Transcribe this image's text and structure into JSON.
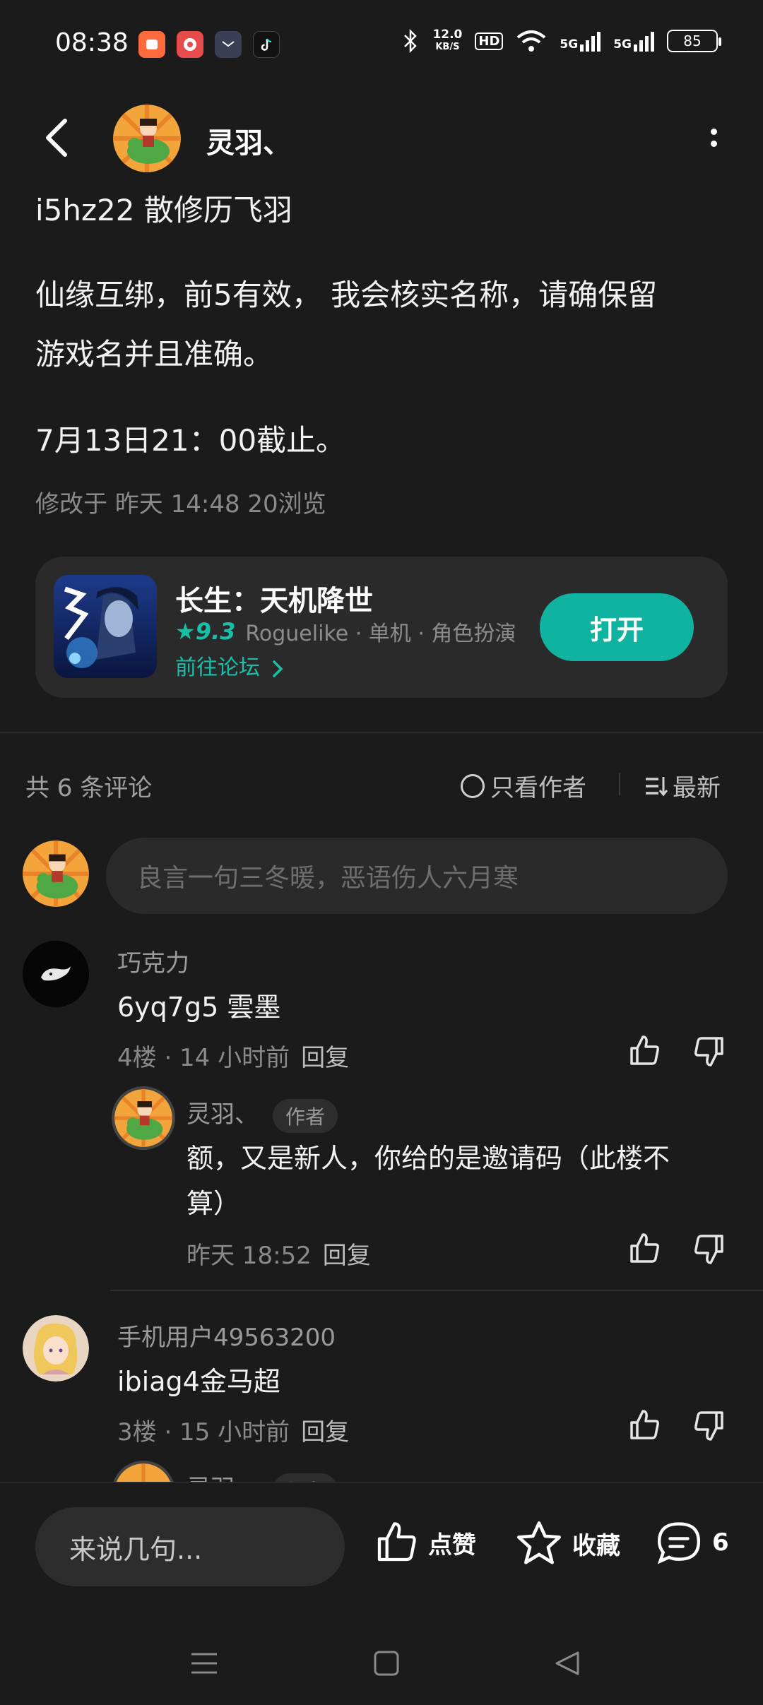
{
  "status_bar": {
    "time": "08:38",
    "speed_value": "12.0",
    "speed_unit": "KB/S",
    "hd_label": "HD",
    "sig1_label": "5G",
    "sig2_label": "5G",
    "battery": "85",
    "icons": [
      "app-notification-orange",
      "app-notification-red",
      "app-notification-mail",
      "tiktok-icon",
      "bluetooth-icon",
      "wifi-icon"
    ]
  },
  "header": {
    "author_name": "灵羽、"
  },
  "post": {
    "line1": "i5hz22 散修历飞羽",
    "line2": "仙缘互绑，前5有效， 我会核实名称，请确保留",
    "line3": "游戏名并且准确。",
    "line4": "7月13日21：00截止。",
    "meta": "修改于 昨天 14:48  20浏览"
  },
  "game_card": {
    "title": "长生：天机降世",
    "rating": "9.3",
    "tags": "Roguelike · 单机 · 角色扮演",
    "forum_link": "前往论坛",
    "open_label": "打开"
  },
  "comments_bar": {
    "count_label": "共 6 条评论",
    "only_author_label": "只看作者",
    "sort_label": "最新"
  },
  "comment_input": {
    "placeholder": "良言一句三冬暖，恶语伤人六月寒"
  },
  "comments": [
    {
      "name": "巧克力",
      "text": "6yq7g5 雲墨",
      "floor_time": "4楼 · 14 小时前",
      "reply_label": "回复"
    },
    {
      "name": "手机用户49563200",
      "text": "ibiag4金马超",
      "floor_time": "3楼 · 15 小时前",
      "reply_label": "回复"
    }
  ],
  "author_reply": {
    "name": "灵羽、",
    "badge": "作者",
    "text_line1": "额，又是新人，你给的是邀请码（此楼不",
    "text_line2": "算）",
    "time": "昨天 18:52",
    "reply_label": "回复"
  },
  "partial_reply": {
    "name": "灵羽、",
    "badge": "作者"
  },
  "bottom_bar": {
    "input_placeholder": "来说几句...",
    "like_label": "点赞",
    "fav_label": "收藏",
    "comment_count": "6"
  },
  "colors": {
    "background": "#1b1b1b",
    "accent": "#10b3a0",
    "card": "#2a2a2a"
  }
}
